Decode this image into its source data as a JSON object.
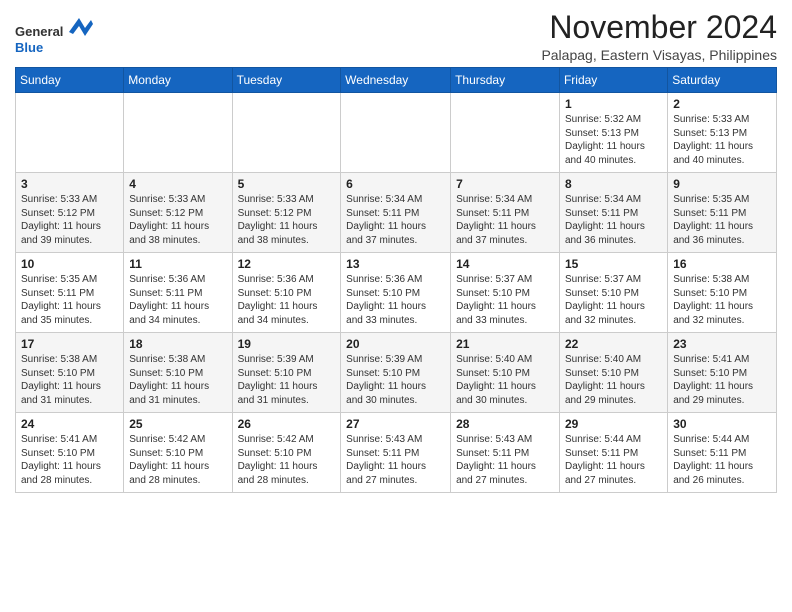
{
  "header": {
    "logo_line1": "General",
    "logo_line2": "Blue",
    "month_title": "November 2024",
    "location": "Palapag, Eastern Visayas, Philippines"
  },
  "calendar": {
    "days_of_week": [
      "Sunday",
      "Monday",
      "Tuesday",
      "Wednesday",
      "Thursday",
      "Friday",
      "Saturday"
    ],
    "weeks": [
      [
        {
          "day": "",
          "info": ""
        },
        {
          "day": "",
          "info": ""
        },
        {
          "day": "",
          "info": ""
        },
        {
          "day": "",
          "info": ""
        },
        {
          "day": "",
          "info": ""
        },
        {
          "day": "1",
          "info": "Sunrise: 5:32 AM\nSunset: 5:13 PM\nDaylight: 11 hours\nand 40 minutes."
        },
        {
          "day": "2",
          "info": "Sunrise: 5:33 AM\nSunset: 5:13 PM\nDaylight: 11 hours\nand 40 minutes."
        }
      ],
      [
        {
          "day": "3",
          "info": "Sunrise: 5:33 AM\nSunset: 5:12 PM\nDaylight: 11 hours\nand 39 minutes."
        },
        {
          "day": "4",
          "info": "Sunrise: 5:33 AM\nSunset: 5:12 PM\nDaylight: 11 hours\nand 38 minutes."
        },
        {
          "day": "5",
          "info": "Sunrise: 5:33 AM\nSunset: 5:12 PM\nDaylight: 11 hours\nand 38 minutes."
        },
        {
          "day": "6",
          "info": "Sunrise: 5:34 AM\nSunset: 5:11 PM\nDaylight: 11 hours\nand 37 minutes."
        },
        {
          "day": "7",
          "info": "Sunrise: 5:34 AM\nSunset: 5:11 PM\nDaylight: 11 hours\nand 37 minutes."
        },
        {
          "day": "8",
          "info": "Sunrise: 5:34 AM\nSunset: 5:11 PM\nDaylight: 11 hours\nand 36 minutes."
        },
        {
          "day": "9",
          "info": "Sunrise: 5:35 AM\nSunset: 5:11 PM\nDaylight: 11 hours\nand 36 minutes."
        }
      ],
      [
        {
          "day": "10",
          "info": "Sunrise: 5:35 AM\nSunset: 5:11 PM\nDaylight: 11 hours\nand 35 minutes."
        },
        {
          "day": "11",
          "info": "Sunrise: 5:36 AM\nSunset: 5:11 PM\nDaylight: 11 hours\nand 34 minutes."
        },
        {
          "day": "12",
          "info": "Sunrise: 5:36 AM\nSunset: 5:10 PM\nDaylight: 11 hours\nand 34 minutes."
        },
        {
          "day": "13",
          "info": "Sunrise: 5:36 AM\nSunset: 5:10 PM\nDaylight: 11 hours\nand 33 minutes."
        },
        {
          "day": "14",
          "info": "Sunrise: 5:37 AM\nSunset: 5:10 PM\nDaylight: 11 hours\nand 33 minutes."
        },
        {
          "day": "15",
          "info": "Sunrise: 5:37 AM\nSunset: 5:10 PM\nDaylight: 11 hours\nand 32 minutes."
        },
        {
          "day": "16",
          "info": "Sunrise: 5:38 AM\nSunset: 5:10 PM\nDaylight: 11 hours\nand 32 minutes."
        }
      ],
      [
        {
          "day": "17",
          "info": "Sunrise: 5:38 AM\nSunset: 5:10 PM\nDaylight: 11 hours\nand 31 minutes."
        },
        {
          "day": "18",
          "info": "Sunrise: 5:38 AM\nSunset: 5:10 PM\nDaylight: 11 hours\nand 31 minutes."
        },
        {
          "day": "19",
          "info": "Sunrise: 5:39 AM\nSunset: 5:10 PM\nDaylight: 11 hours\nand 31 minutes."
        },
        {
          "day": "20",
          "info": "Sunrise: 5:39 AM\nSunset: 5:10 PM\nDaylight: 11 hours\nand 30 minutes."
        },
        {
          "day": "21",
          "info": "Sunrise: 5:40 AM\nSunset: 5:10 PM\nDaylight: 11 hours\nand 30 minutes."
        },
        {
          "day": "22",
          "info": "Sunrise: 5:40 AM\nSunset: 5:10 PM\nDaylight: 11 hours\nand 29 minutes."
        },
        {
          "day": "23",
          "info": "Sunrise: 5:41 AM\nSunset: 5:10 PM\nDaylight: 11 hours\nand 29 minutes."
        }
      ],
      [
        {
          "day": "24",
          "info": "Sunrise: 5:41 AM\nSunset: 5:10 PM\nDaylight: 11 hours\nand 28 minutes."
        },
        {
          "day": "25",
          "info": "Sunrise: 5:42 AM\nSunset: 5:10 PM\nDaylight: 11 hours\nand 28 minutes."
        },
        {
          "day": "26",
          "info": "Sunrise: 5:42 AM\nSunset: 5:10 PM\nDaylight: 11 hours\nand 28 minutes."
        },
        {
          "day": "27",
          "info": "Sunrise: 5:43 AM\nSunset: 5:11 PM\nDaylight: 11 hours\nand 27 minutes."
        },
        {
          "day": "28",
          "info": "Sunrise: 5:43 AM\nSunset: 5:11 PM\nDaylight: 11 hours\nand 27 minutes."
        },
        {
          "day": "29",
          "info": "Sunrise: 5:44 AM\nSunset: 5:11 PM\nDaylight: 11 hours\nand 27 minutes."
        },
        {
          "day": "30",
          "info": "Sunrise: 5:44 AM\nSunset: 5:11 PM\nDaylight: 11 hours\nand 26 minutes."
        }
      ]
    ]
  }
}
